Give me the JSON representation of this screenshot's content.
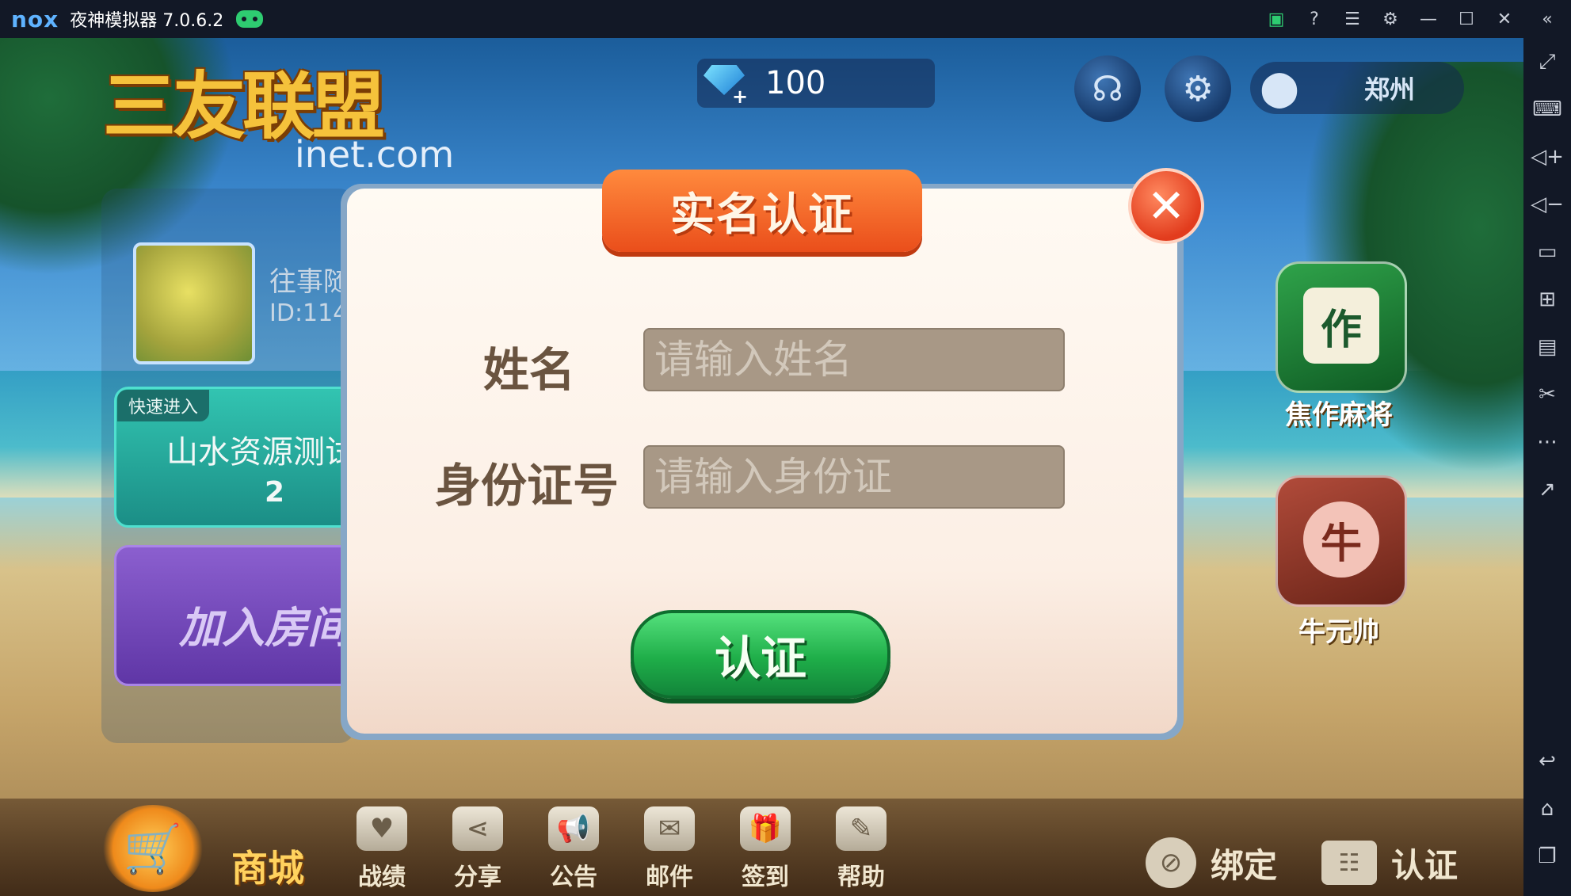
{
  "titlebar": {
    "logo": "nox",
    "title": "夜神模拟器 7.0.6.2",
    "icons": [
      "gamepad-icon",
      "store-icon",
      "help-icon",
      "menu-icon",
      "settings-icon",
      "minimize-icon",
      "maximize-icon",
      "close-icon",
      "collapse-icon"
    ]
  },
  "sidebar": {
    "icons": [
      "fullscreen-icon",
      "keyboard-icon",
      "volume-up-icon",
      "volume-down-icon",
      "screen-icon",
      "apk-install-icon",
      "multi-instance-icon",
      "screenshot-icon",
      "more-icon",
      "export-icon",
      "back-icon",
      "home-icon",
      "recent-apps-icon"
    ]
  },
  "game": {
    "logo": "三友联盟",
    "site": "inet.com",
    "diamonds": "100",
    "location": "郑州",
    "player": {
      "name": "往事随",
      "id": "ID:114"
    },
    "quick_entry": {
      "tag": "快速进入",
      "room": "山水资源测试",
      "number": "2"
    },
    "join_room": "加入房间",
    "games": [
      {
        "label": "焦作麻将",
        "icon": "作"
      },
      {
        "label": "牛元帅",
        "icon": "牛"
      }
    ],
    "bottom": {
      "shop": "商城",
      "nav": [
        "战绩",
        "分享",
        "公告",
        "邮件",
        "签到",
        "帮助"
      ],
      "bind": "绑定",
      "verify": "认证"
    }
  },
  "modal": {
    "title": "实名认证",
    "name_label": "姓名",
    "name_placeholder": "请输入姓名",
    "id_label": "身份证号",
    "id_placeholder": "请输入身份证",
    "submit": "认证"
  },
  "colors": {
    "modal_title": "#ea4e1b",
    "submit_green": "#1fae49",
    "close_red": "#e23c1d"
  }
}
